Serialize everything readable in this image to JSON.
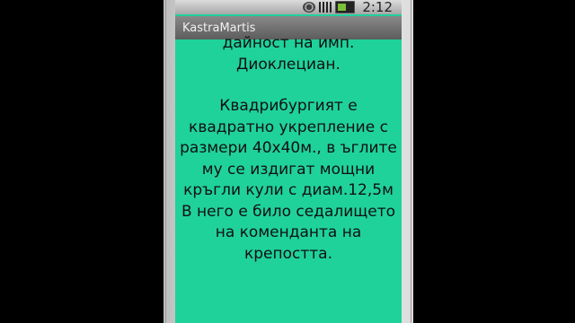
{
  "status_bar": {
    "time": "2:12",
    "icons": [
      "sync-icon",
      "signal-icon",
      "battery-icon"
    ]
  },
  "app": {
    "title": "KastraMartis"
  },
  "content": {
    "paragraph_1": [
      "дайност на имп.",
      "Диоклециан."
    ],
    "paragraph_2": [
      "Квадрибургият е",
      "квадратно укрепление с",
      "размери 40х40м., в ъглите",
      "му се издигат мощни",
      "кръгли кули с диам.12,5м",
      "В него е било седалището",
      "на коменданта на",
      "крепостта."
    ]
  },
  "colors": {
    "screen_background": "#1fd29a",
    "title_bar": "#6e6e6e",
    "text": "#101010"
  }
}
